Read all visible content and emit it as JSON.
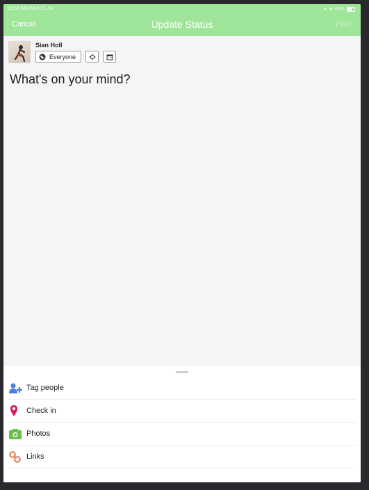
{
  "status_bar": {
    "time_date": "11:56 AM  Wed 31 Jul",
    "battery": "65%"
  },
  "nav": {
    "cancel_label": "Cancel",
    "title": "Update Status",
    "post_label": "Post"
  },
  "composer": {
    "author_name": "Sian Holl",
    "audience_label": "Everyone",
    "prompt": "What's on your mind?"
  },
  "actions": [
    {
      "label": "Tag people",
      "icon": "tag-people-icon",
      "color": "#4a7fe0"
    },
    {
      "label": "Check in",
      "icon": "location-pin-icon",
      "color": "#d81b60"
    },
    {
      "label": "Photos",
      "icon": "camera-icon",
      "color": "#6cc04a"
    },
    {
      "label": "Links",
      "icon": "link-icon",
      "color": "#e8734a"
    }
  ],
  "colors": {
    "nav_bg": "#9fe69a",
    "compose_bg": "#f5f5f5"
  }
}
